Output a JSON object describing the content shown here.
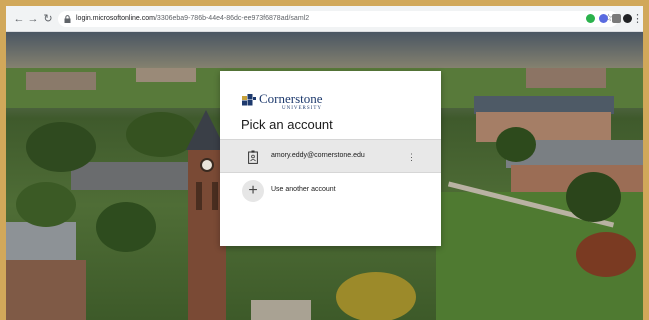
{
  "browser": {
    "url_host": "login.microsoftonline.com",
    "url_path": "/3306eba9-786b-44e4-86dc-ee973f6878ad/saml2"
  },
  "card": {
    "brand_name": "Cornerstone",
    "brand_sub": "UNIVERSITY",
    "title": "Pick an account",
    "account_email": "amory.eddy@cornerstone.edu",
    "add_account_label": "Use another account"
  },
  "colors": {
    "brand": "#1e3a6d",
    "logo_gold": "#c8a23a"
  },
  "icons": {
    "back": "back-arrow-icon",
    "forward": "forward-arrow-icon",
    "reload": "reload-icon",
    "lock": "lock-icon",
    "star": "star-icon",
    "more": "more-vertical-icon",
    "plus": "plus-icon",
    "account": "badge-icon"
  }
}
